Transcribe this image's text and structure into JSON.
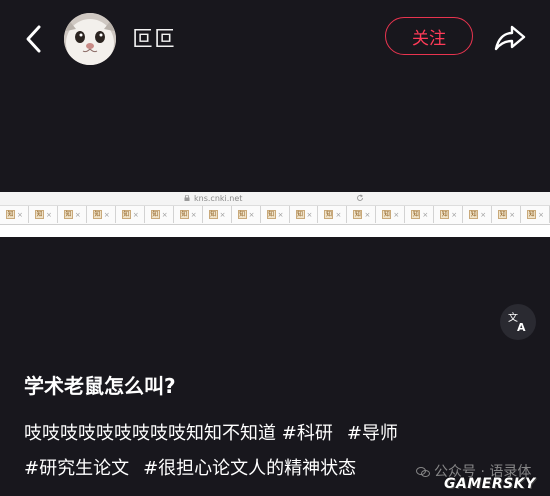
{
  "header": {
    "username": "叵叵",
    "follow_label": "关注",
    "back_icon": "chevron-left-icon",
    "share_icon": "share-arrow-icon",
    "avatar_desc": "avatar"
  },
  "embedded_screenshot": {
    "url": "kns.cnki.net",
    "tab_favicon_text": "知",
    "tab_count": 19
  },
  "post": {
    "title": "学术老鼠怎么叫?",
    "line1_text": "吱吱吱吱吱吱吱吱吱知知不知道",
    "tag_research": "#科研",
    "tag_advisor": "#导师",
    "tag_thesis": "#研究生论文",
    "tag_spirit": "#很担心论文人的精神状态"
  },
  "watermark": {
    "text": "公众号 · 语录体",
    "logo": "GAMERSKY"
  },
  "colors": {
    "background": "#18171d",
    "accent": "#ff3b58",
    "text": "#ffffff"
  }
}
